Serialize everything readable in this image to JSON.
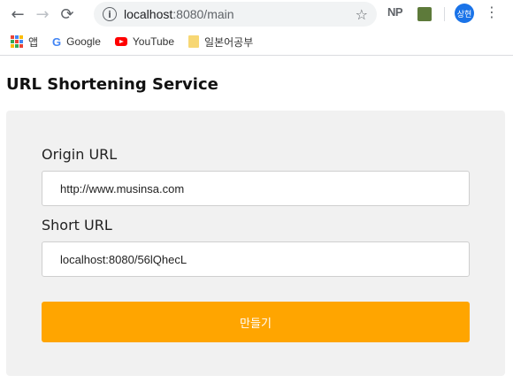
{
  "browser": {
    "address": {
      "host": "localhost",
      "path": ":8080/main"
    },
    "extensions": {
      "np_label": "NP"
    },
    "profile": {
      "avatar_text": "상현"
    },
    "bookmarks": [
      {
        "label": "앱",
        "icon": "apps-grid-icon"
      },
      {
        "label": "Google",
        "icon": "google-icon"
      },
      {
        "label": "YouTube",
        "icon": "youtube-icon"
      },
      {
        "label": "일본어공부",
        "icon": "folder-icon"
      }
    ]
  },
  "page": {
    "title": "URL Shortening Service",
    "form": {
      "origin_label": "Origin URL",
      "origin_value": "http://www.musinsa.com",
      "short_label": "Short URL",
      "short_value": "localhost:8080/56lQhecL",
      "submit_label": "만들기"
    }
  },
  "colors": {
    "accent": "#ffa500",
    "card_bg": "#f1f1f1",
    "avatar_bg": "#1a73e8"
  }
}
